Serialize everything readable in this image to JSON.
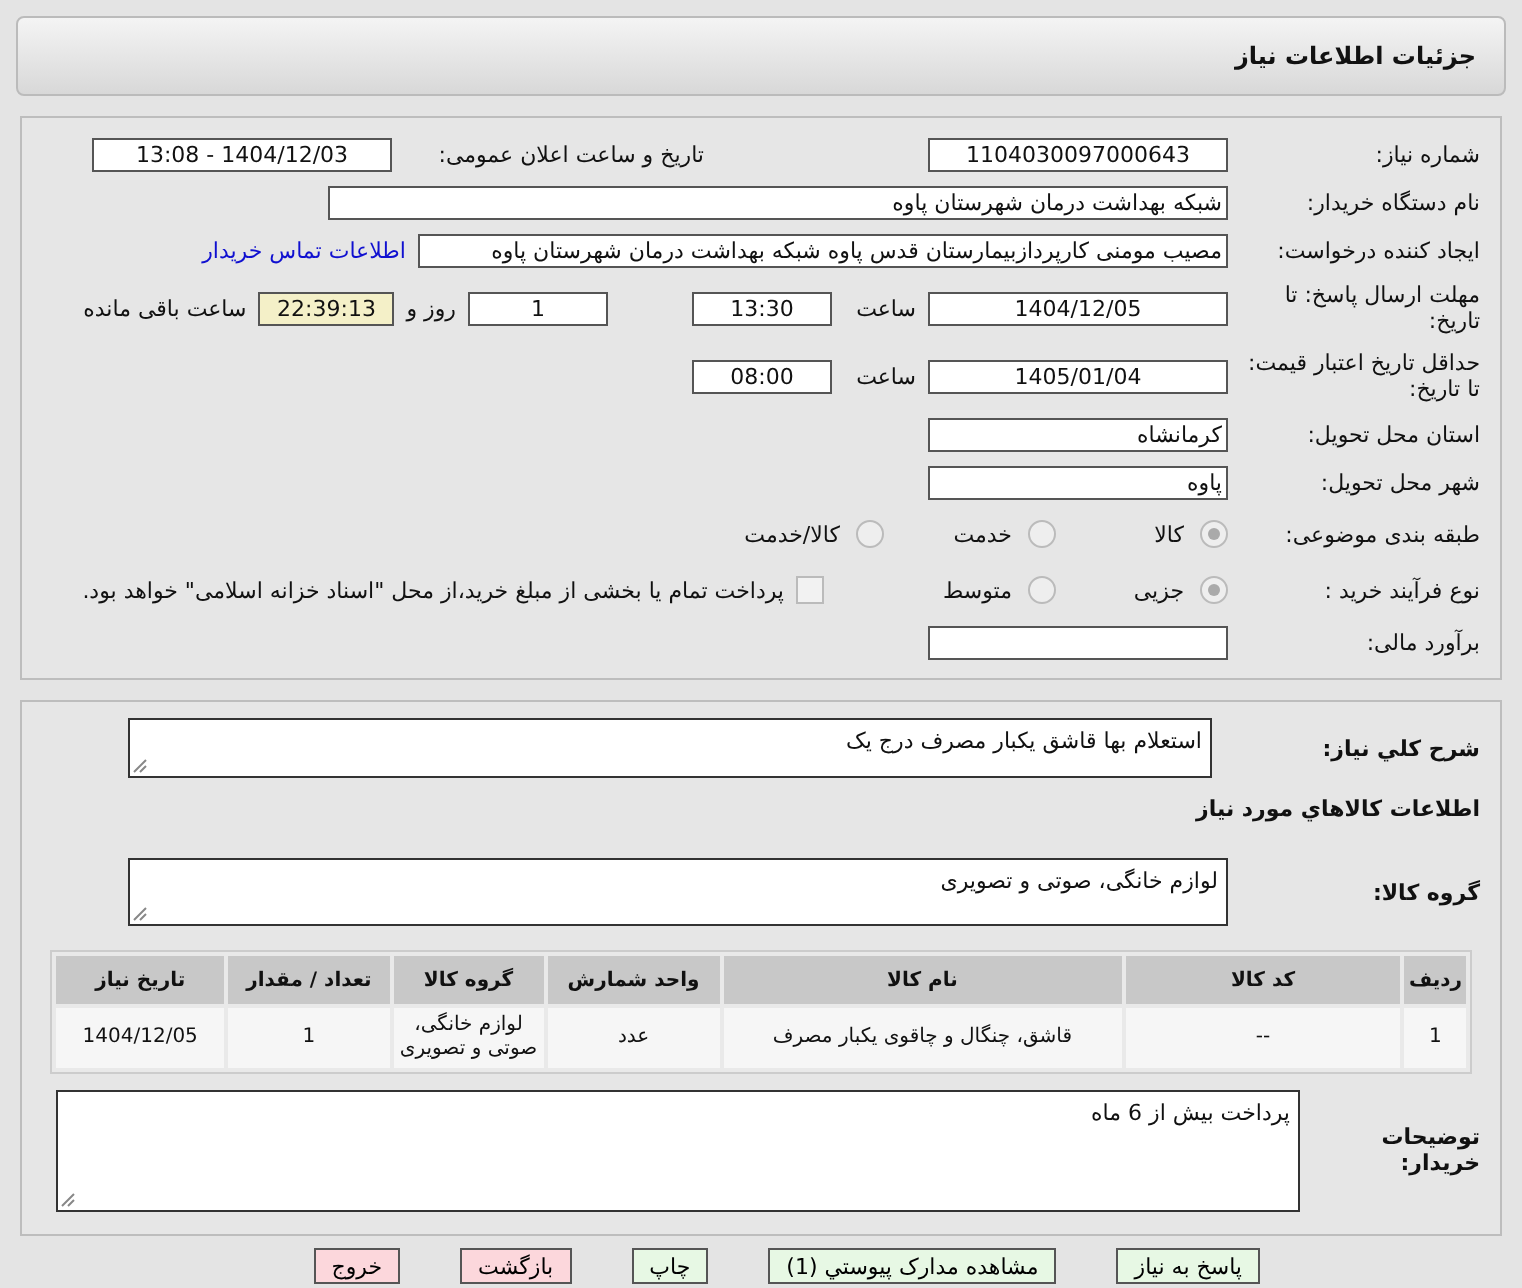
{
  "header": {
    "title": "جزئیات اطلاعات نیاز"
  },
  "need_number": {
    "label": "شماره نیاز:",
    "value": "1104030097000643"
  },
  "announce": {
    "label": "تاریخ و ساعت اعلان عمومی:",
    "value": "1404/12/03 - 13:08"
  },
  "buyer_org": {
    "label": "نام دستگاه خریدار:",
    "value": "شبکه بهداشت درمان شهرستان پاوه"
  },
  "requester": {
    "label": "ایجاد کننده درخواست:",
    "value": "مصیب مومنی کارپردازبیمارستان قدس پاوه شبکه بهداشت درمان شهرستان پاوه",
    "link": "اطلاعات تماس خریدار"
  },
  "deadline": {
    "label": "مهلت ارسال پاسخ: تا تاریخ:",
    "date": "1404/12/05",
    "time_label": "ساعت",
    "time": "13:30",
    "days": "1",
    "days_label": "روز و",
    "remaining": "22:39:13",
    "remaining_label": "ساعت باقی مانده"
  },
  "validity": {
    "label": "حداقل تاریخ اعتبار قیمت: تا تاریخ:",
    "date": "1405/01/04",
    "time_label": "ساعت",
    "time": "08:00"
  },
  "province": {
    "label": "استان محل تحویل:",
    "value": "کرمانشاه"
  },
  "city": {
    "label": "شهر محل تحویل:",
    "value": "پاوه"
  },
  "category": {
    "label": "طبقه بندی موضوعی:",
    "options": [
      {
        "label": "کالا",
        "selected": true
      },
      {
        "label": "خدمت",
        "selected": false
      },
      {
        "label": "کالا/خدمت",
        "selected": false
      }
    ]
  },
  "process": {
    "label": "نوع فرآیند خرید :",
    "options": [
      {
        "label": "جزیی",
        "selected": true
      },
      {
        "label": "متوسط",
        "selected": false
      }
    ],
    "payment": {
      "label": "پرداخت تمام یا بخشی از مبلغ خرید،از محل \"اسناد خزانه اسلامی\" خواهد بود.",
      "checked": false
    }
  },
  "budget": {
    "label": "برآورد مالی:"
  },
  "description": {
    "label": "شرح کلي نیاز:",
    "value": "استعلام بها قاشق یکبار مصرف درج یک"
  },
  "goods_heading": "اطلاعات کالاهاي مورد نیاز",
  "goods_group": {
    "label": "گروه کالا:",
    "value": "لوازم خانگی، صوتی و تصویری"
  },
  "table": {
    "columns": [
      "ردیف",
      "کد کالا",
      "نام کالا",
      "واحد شمارش",
      "گروه کالا",
      "تعداد / مقدار",
      "تاریخ نیاز"
    ],
    "rows": [
      [
        "1",
        "--",
        "قاشق، چنگال و چاقوی یکبار مصرف",
        "عدد",
        "لوازم خانگی، صوتی و تصویری",
        "1",
        "1404/12/05"
      ]
    ]
  },
  "notes": {
    "label": "توضیحات خریدار:",
    "value": "پرداخت بیش از 6 ماه"
  },
  "buttons": [
    {
      "label": "پاسخ به نیاز",
      "kind": "normal"
    },
    {
      "label": "مشاهده مدارک پیوستي (1)",
      "kind": "normal"
    },
    {
      "label": "چاپ",
      "kind": "normal"
    },
    {
      "label": "بازگشت",
      "kind": "danger"
    },
    {
      "label": "خروج",
      "kind": "danger"
    }
  ]
}
